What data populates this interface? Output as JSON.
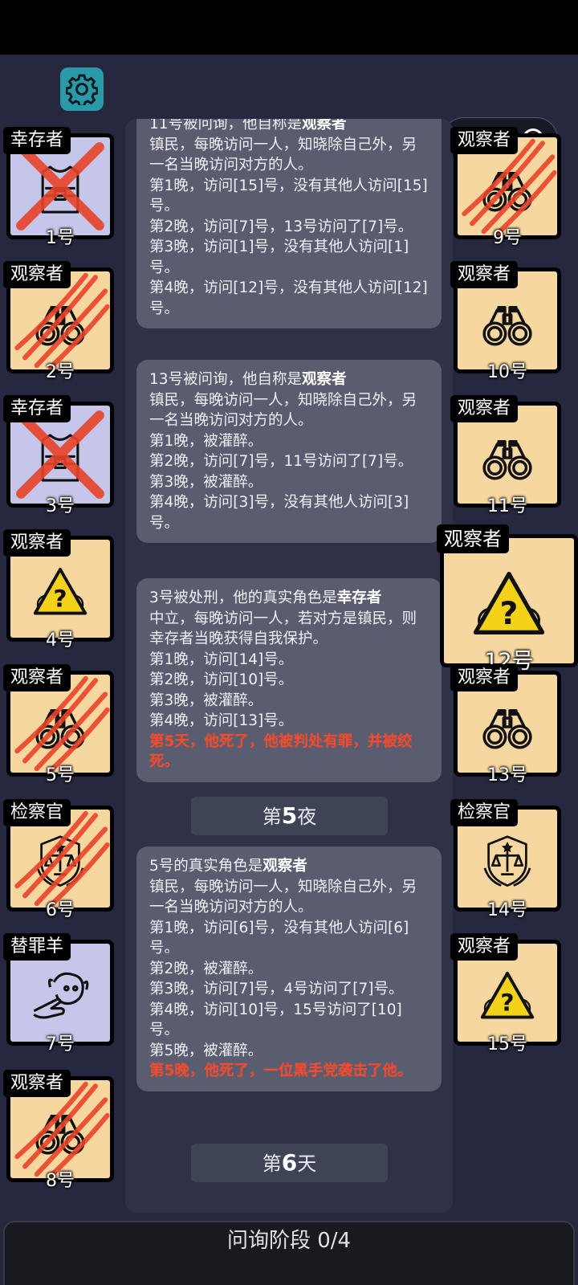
{
  "players": [
    {
      "num": "1号",
      "role": "幸存者",
      "icon": "vest-icon",
      "bg": "lavender",
      "dead": true,
      "mark": "x"
    },
    {
      "num": "2号",
      "role": "观察者",
      "icon": "binoculars-icon",
      "bg": "tan",
      "dead": true,
      "mark": "claw"
    },
    {
      "num": "3号",
      "role": "幸存者",
      "icon": "vest-icon",
      "bg": "lavender",
      "dead": true,
      "mark": "x"
    },
    {
      "num": "4号",
      "role": "观察者",
      "icon": "warning-icon",
      "bg": "tan",
      "dead": false
    },
    {
      "num": "5号",
      "role": "观察者",
      "icon": "binoculars-icon",
      "bg": "tan",
      "dead": true,
      "mark": "claw"
    },
    {
      "num": "6号",
      "role": "检察官",
      "icon": "justice-badge-icon",
      "bg": "tan",
      "dead": true,
      "mark": "claw"
    },
    {
      "num": "7号",
      "role": "替罪羊",
      "icon": "scapegoat-icon",
      "bg": "lavender",
      "dead": false
    },
    {
      "num": "8号",
      "role": "观察者",
      "icon": "binoculars-icon",
      "bg": "tan",
      "dead": true,
      "mark": "claw"
    },
    {
      "num": "9号",
      "role": "观察者",
      "icon": "binoculars-icon",
      "bg": "tan",
      "dead": true,
      "mark": "claw"
    },
    {
      "num": "10号",
      "role": "观察者",
      "icon": "binoculars-icon",
      "bg": "tan",
      "dead": false
    },
    {
      "num": "11号",
      "role": "观察者",
      "icon": "binoculars-icon",
      "bg": "tan",
      "dead": false
    },
    {
      "num": "12号",
      "role": "观察者",
      "icon": "warning-icon",
      "bg": "tan",
      "dead": false,
      "selected": true
    },
    {
      "num": "13号",
      "role": "观察者",
      "icon": "binoculars-icon",
      "bg": "tan",
      "dead": false
    },
    {
      "num": "14号",
      "role": "检察官",
      "icon": "justice-badge-icon",
      "bg": "tan",
      "dead": false
    },
    {
      "num": "15号",
      "role": "观察者",
      "icon": "warning-icon",
      "bg": "tan",
      "dead": false
    }
  ],
  "messages": [
    {
      "header": "11号被问询，他自称是",
      "header_role": "观察者",
      "lines": [
        "镇民，每晚访问一人，知晓除自己外，另一名当晚访问对方的人。",
        "第1晚，访问[15]号，没有其他人访问[15]号。",
        "第2晚，访问[7]号，13号访问了[7]号。",
        "第3晚，访问[1]号，没有其他人访问[1]号。",
        "第4晚，访问[12]号，没有其他人访问[12]号。"
      ],
      "red": ""
    },
    {
      "header": "13号被问询，他自称是",
      "header_role": "观察者",
      "lines": [
        "镇民，每晚访问一人，知晓除自己外，另一名当晚访问对方的人。",
        "第1晚，被灌醉。",
        "第2晚，访问[7]号，11号访问了[7]号。",
        "第3晚，被灌醉。",
        "第4晚，访问[3]号，没有其他人访问[3]号。"
      ],
      "red": ""
    },
    {
      "header": "3号被处刑，他的真实角色是",
      "header_role": "幸存者",
      "lines": [
        "中立，每晚访问一人，若对方是镇民，则幸存者当晚获得自我保护。",
        "第1晚，访问[14]号。",
        "第2晚，访问[10]号。",
        "第3晚，被灌醉。",
        "第4晚，访问[13]号。"
      ],
      "red": "第5天，他死了，他被判处有罪，并被绞死。"
    },
    {
      "header": "5号的真实角色是",
      "header_role": "观察者",
      "lines": [
        "镇民，每晚访问一人，知晓除自己外，另一名当晚访问对方的人。",
        "第1晚，访问[6]号，没有其他人访问[6]号。",
        "第2晚，被灌醉。",
        "第3晚，访问[7]号，4号访问了[7]号。",
        "第4晚，访问[10]号，15号访问了[10]号。",
        "第5晚，被灌醉。"
      ],
      "red": "第5晚，他死了，一位黑手党袭击了他。"
    }
  ],
  "dividers": [
    {
      "prefix": "第",
      "number": "5",
      "suffix": "夜"
    },
    {
      "prefix": "第",
      "number": "6",
      "suffix": "天"
    }
  ],
  "phase": {
    "label": "问询阶段 0/4"
  },
  "colors": {
    "claw": "#e8432a",
    "x": "#e8432a",
    "card_tan": "#f7d7a0",
    "card_lavender": "#c5c6e9",
    "gear": "#2a9aa8"
  }
}
